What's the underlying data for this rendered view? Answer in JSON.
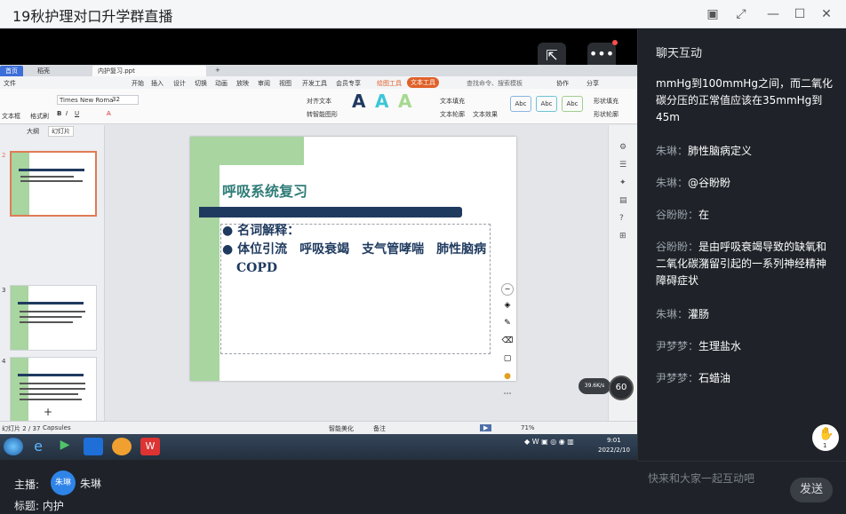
{
  "window": {
    "title": "19秋护理对口升学群直播"
  },
  "ppt": {
    "tabs": [
      "首页",
      "稻壳",
      "内护复习.ppt"
    ],
    "menu": [
      "文件",
      "开始",
      "插入",
      "设计",
      "切换",
      "动画",
      "放映",
      "审阅",
      "视图",
      "开发工具",
      "会员专享",
      "绘图工具",
      "文本工具",
      "查找命令、搜索模板",
      "协作",
      "分享"
    ],
    "ribbon": {
      "font_name": "Times New Roma",
      "font_size": "32",
      "text_box": "文本框",
      "format_brush": "格式刷",
      "align_text": "对齐文本",
      "smart_graphic": "转智能图形",
      "text_fill": "文本填充",
      "text_outline": "文本轮廓",
      "text_effect": "文本效果",
      "shape_fill": "形状填充",
      "shape_outline": "形状轮廓",
      "style_label": "Abc"
    },
    "panel_tabs": [
      "大纲",
      "幻灯片"
    ],
    "thumb_numbers": [
      "2",
      "3",
      "4"
    ],
    "slide": {
      "title": "呼吸系统复习",
      "bullets": [
        "名词解释：",
        "体位引流　呼吸衰竭　支气管哮喘　肺性脑病　COPD"
      ]
    },
    "status": {
      "slide_count": "幻灯片 2 / 37",
      "theme": "Capsules",
      "smart_beautify": "智能美化",
      "notes": "备注",
      "zoom": "71%"
    },
    "taskbar": {
      "time": "9:01",
      "date": "2022/2/10"
    },
    "speed": "39.6K/s",
    "speed_pct": "60"
  },
  "chat": {
    "title": "聊天互动",
    "messages": [
      {
        "name": "",
        "text": "mmHg到100mmHg之间，而二氧化碳分压的正常值应该在35mmHg到45m"
      },
      {
        "name": "朱琳：",
        "text": "肺性脑病定义"
      },
      {
        "name": "朱琳：",
        "text": "@谷盼盼"
      },
      {
        "name": "谷盼盼：",
        "text": "在"
      },
      {
        "name": "谷盼盼：",
        "text": "是由呼吸衰竭导致的缺氧和二氧化碳潴留引起的一系列神经精神障碍症状"
      },
      {
        "name": "朱琳：",
        "text": "灌肠"
      },
      {
        "name": "尹梦梦：",
        "text": "生理盐水"
      },
      {
        "name": "尹梦梦：",
        "text": "石蜡油"
      }
    ],
    "input_placeholder": "快来和大家一起互动吧",
    "send_label": "发送",
    "like_count": "1"
  },
  "footer": {
    "host_label": "主播:",
    "host_avatar": "朱琳",
    "host_name": "朱琳",
    "topic_label": "标题:",
    "topic": "内护"
  },
  "colors": {
    "accent": "#2f84e8",
    "slide_green": "#a8d5a0",
    "slide_navy": "#1f3a5f",
    "title_teal": "#2f7d78"
  }
}
